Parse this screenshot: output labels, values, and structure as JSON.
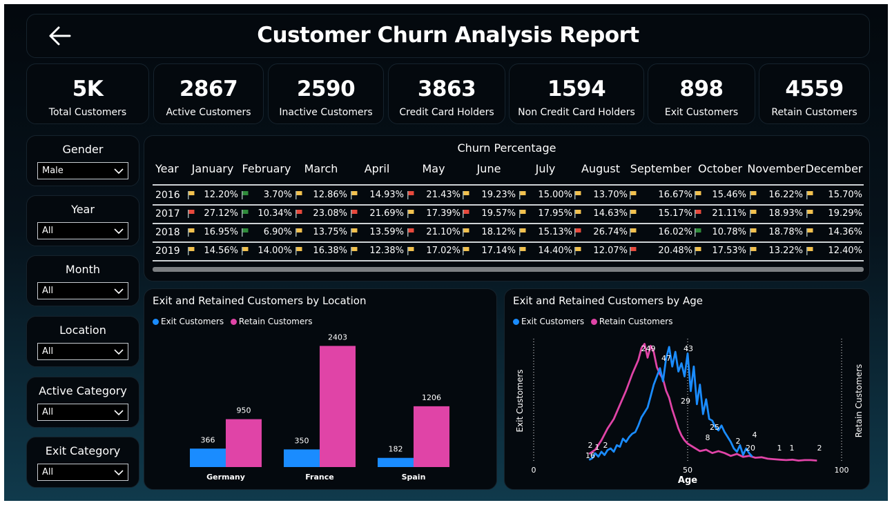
{
  "header": {
    "title": "Customer Churn Analysis Report",
    "back_icon": "arrow-left-icon"
  },
  "kpis": [
    {
      "value": "5K",
      "label": "Total Customers"
    },
    {
      "value": "2867",
      "label": "Active Customers"
    },
    {
      "value": "2590",
      "label": "Inactive Customers"
    },
    {
      "value": "3863",
      "label": "Credit Card Holders"
    },
    {
      "value": "1594",
      "label": "Non Credit Card Holders"
    },
    {
      "value": "898",
      "label": "Exit Customers"
    },
    {
      "value": "4559",
      "label": "Retain Customers"
    }
  ],
  "slicers": [
    {
      "title": "Gender",
      "value": "Male"
    },
    {
      "title": "Year",
      "value": "All"
    },
    {
      "title": "Month",
      "value": "All"
    },
    {
      "title": "Location",
      "value": "All"
    },
    {
      "title": "Active Category",
      "value": "All"
    },
    {
      "title": "Exit Category",
      "value": "All"
    }
  ],
  "churn": {
    "title": "Churn Percentage",
    "year_header": "Year",
    "months": [
      "January",
      "February",
      "March",
      "April",
      "May",
      "June",
      "July",
      "August",
      "September",
      "October",
      "November",
      "December"
    ],
    "flag_colors": {
      "yellow": "#f2c14e",
      "green": "#2e8b3a",
      "red": "#e8493c"
    },
    "rows": [
      {
        "year": "2016",
        "cells": [
          [
            "12.20%",
            "yellow"
          ],
          [
            "3.70%",
            "green"
          ],
          [
            "12.86%",
            "yellow"
          ],
          [
            "14.93%",
            "yellow"
          ],
          [
            "21.43%",
            "red"
          ],
          [
            "19.23%",
            "yellow"
          ],
          [
            "15.00%",
            "yellow"
          ],
          [
            "13.70%",
            "yellow"
          ],
          [
            "16.67%",
            "yellow"
          ],
          [
            "15.46%",
            "yellow"
          ],
          [
            "16.22%",
            "yellow"
          ],
          [
            "15.70%",
            "yellow"
          ]
        ]
      },
      {
        "year": "2017",
        "cells": [
          [
            "27.12%",
            "red"
          ],
          [
            "10.34%",
            "green"
          ],
          [
            "23.08%",
            "red"
          ],
          [
            "21.69%",
            "red"
          ],
          [
            "17.39%",
            "yellow"
          ],
          [
            "19.57%",
            "red"
          ],
          [
            "17.95%",
            "yellow"
          ],
          [
            "14.63%",
            "yellow"
          ],
          [
            "15.17%",
            "yellow"
          ],
          [
            "21.11%",
            "red"
          ],
          [
            "18.93%",
            "yellow"
          ],
          [
            "19.29%",
            "yellow"
          ]
        ]
      },
      {
        "year": "2018",
        "cells": [
          [
            "16.95%",
            "yellow"
          ],
          [
            "6.90%",
            "green"
          ],
          [
            "13.75%",
            "yellow"
          ],
          [
            "13.59%",
            "yellow"
          ],
          [
            "21.10%",
            "red"
          ],
          [
            "18.12%",
            "yellow"
          ],
          [
            "15.13%",
            "yellow"
          ],
          [
            "26.74%",
            "red"
          ],
          [
            "16.02%",
            "yellow"
          ],
          [
            "10.78%",
            "green"
          ],
          [
            "18.78%",
            "yellow"
          ],
          [
            "14.36%",
            "yellow"
          ]
        ]
      },
      {
        "year": "2019",
        "cells": [
          [
            "14.56%",
            "yellow"
          ],
          [
            "14.00%",
            "yellow"
          ],
          [
            "16.38%",
            "yellow"
          ],
          [
            "12.38%",
            "yellow"
          ],
          [
            "17.02%",
            "yellow"
          ],
          [
            "17.14%",
            "yellow"
          ],
          [
            "14.40%",
            "yellow"
          ],
          [
            "12.07%",
            "yellow"
          ],
          [
            "20.48%",
            "red"
          ],
          [
            "17.53%",
            "yellow"
          ],
          [
            "13.22%",
            "yellow"
          ],
          [
            "12.40%",
            "yellow"
          ]
        ]
      }
    ]
  },
  "chart_data": [
    {
      "type": "bar",
      "title": "Exit and Retained Customers by Location",
      "categories": [
        "Germany",
        "France",
        "Spain"
      ],
      "series": [
        {
          "name": "Exit Customers",
          "values": [
            366,
            350,
            182
          ],
          "color": "#1a8cff"
        },
        {
          "name": "Retain Customers",
          "values": [
            950,
            2403,
            1206
          ],
          "color": "#e044a7"
        }
      ],
      "ylim": [
        0,
        2600
      ],
      "legend": "top-left"
    },
    {
      "type": "line",
      "title": "Exit and Retained Customers by Age",
      "xlabel": "Age",
      "ylabel_left": "Exit Customers",
      "ylabel_right": "Retain Customers",
      "x_ticks": [
        "0",
        "50",
        "100"
      ],
      "xlim": [
        0,
        100
      ],
      "legend": "top-left",
      "series": [
        {
          "name": "Exit Customers",
          "color": "#1a8cff",
          "axis": "left",
          "ylim": [
            0,
            75
          ],
          "points": [
            [
              18,
              1
            ],
            [
              19,
              2
            ],
            [
              20,
              5
            ],
            [
              21,
              3
            ],
            [
              22,
              6
            ],
            [
              23,
              4
            ],
            [
              24,
              7
            ],
            [
              25,
              8
            ],
            [
              26,
              6
            ],
            [
              27,
              10
            ],
            [
              28,
              9
            ],
            [
              29,
              14
            ],
            [
              30,
              12
            ],
            [
              31,
              15
            ],
            [
              32,
              17
            ],
            [
              33,
              18
            ],
            [
              34,
              22
            ],
            [
              35,
              27
            ],
            [
              36,
              30
            ],
            [
              37,
              33
            ],
            [
              38,
              40
            ],
            [
              39,
              47
            ],
            [
              40,
              52
            ],
            [
              41,
              57
            ],
            [
              42,
              49
            ],
            [
              43,
              63
            ],
            [
              44,
              70
            ],
            [
              45,
              58
            ],
            [
              46,
              67
            ],
            [
              47,
              55
            ],
            [
              48,
              60
            ],
            [
              49,
              52
            ],
            [
              50,
              66
            ],
            [
              51,
              43
            ],
            [
              52,
              58
            ],
            [
              53,
              35
            ],
            [
              54,
              47
            ],
            [
              55,
              29
            ],
            [
              56,
              38
            ],
            [
              57,
              26
            ],
            [
              58,
              25
            ],
            [
              59,
              21
            ],
            [
              60,
              19
            ],
            [
              61,
              22
            ],
            [
              62,
              18
            ],
            [
              63,
              15
            ],
            [
              64,
              12
            ],
            [
              65,
              8
            ],
            [
              66,
              6
            ],
            [
              67,
              10
            ],
            [
              68,
              4
            ],
            [
              69,
              8
            ],
            [
              70,
              5
            ],
            [
              71,
              3
            ]
          ]
        },
        {
          "name": "Retain Customers",
          "color": "#e044a7",
          "axis": "right",
          "ylim": [
            0,
            260
          ],
          "points": [
            [
              18,
              16
            ],
            [
              20,
              25
            ],
            [
              22,
              45
            ],
            [
              24,
              70
            ],
            [
              26,
              90
            ],
            [
              28,
              120
            ],
            [
              30,
              150
            ],
            [
              32,
              185
            ],
            [
              34,
              215
            ],
            [
              35,
              240
            ],
            [
              36,
              249
            ],
            [
              37,
              220
            ],
            [
              38,
              245
            ],
            [
              39,
              232
            ],
            [
              40,
              200
            ],
            [
              41,
              185
            ],
            [
              42,
              175
            ],
            [
              43,
              150
            ],
            [
              44,
              135
            ],
            [
              45,
              110
            ],
            [
              46,
              90
            ],
            [
              47,
              70
            ],
            [
              48,
              55
            ],
            [
              49,
              45
            ],
            [
              50,
              38
            ],
            [
              52,
              30
            ],
            [
              54,
              22
            ],
            [
              56,
              25
            ],
            [
              58,
              18
            ],
            [
              60,
              22
            ],
            [
              62,
              18
            ],
            [
              64,
              12
            ],
            [
              66,
              16
            ],
            [
              68,
              10
            ],
            [
              70,
              12
            ],
            [
              72,
              8
            ],
            [
              74,
              9
            ],
            [
              76,
              6
            ],
            [
              78,
              5
            ],
            [
              80,
              4
            ],
            [
              82,
              3
            ],
            [
              84,
              4
            ],
            [
              86,
              2
            ],
            [
              88,
              3
            ],
            [
              90,
              3
            ],
            [
              92,
              2
            ]
          ]
        }
      ],
      "annotations": [
        "2",
        "1",
        "2",
        "16",
        "249",
        "47",
        "43",
        "29",
        "8",
        "25",
        "2",
        "20",
        "4",
        "1",
        "1",
        "2"
      ]
    }
  ]
}
